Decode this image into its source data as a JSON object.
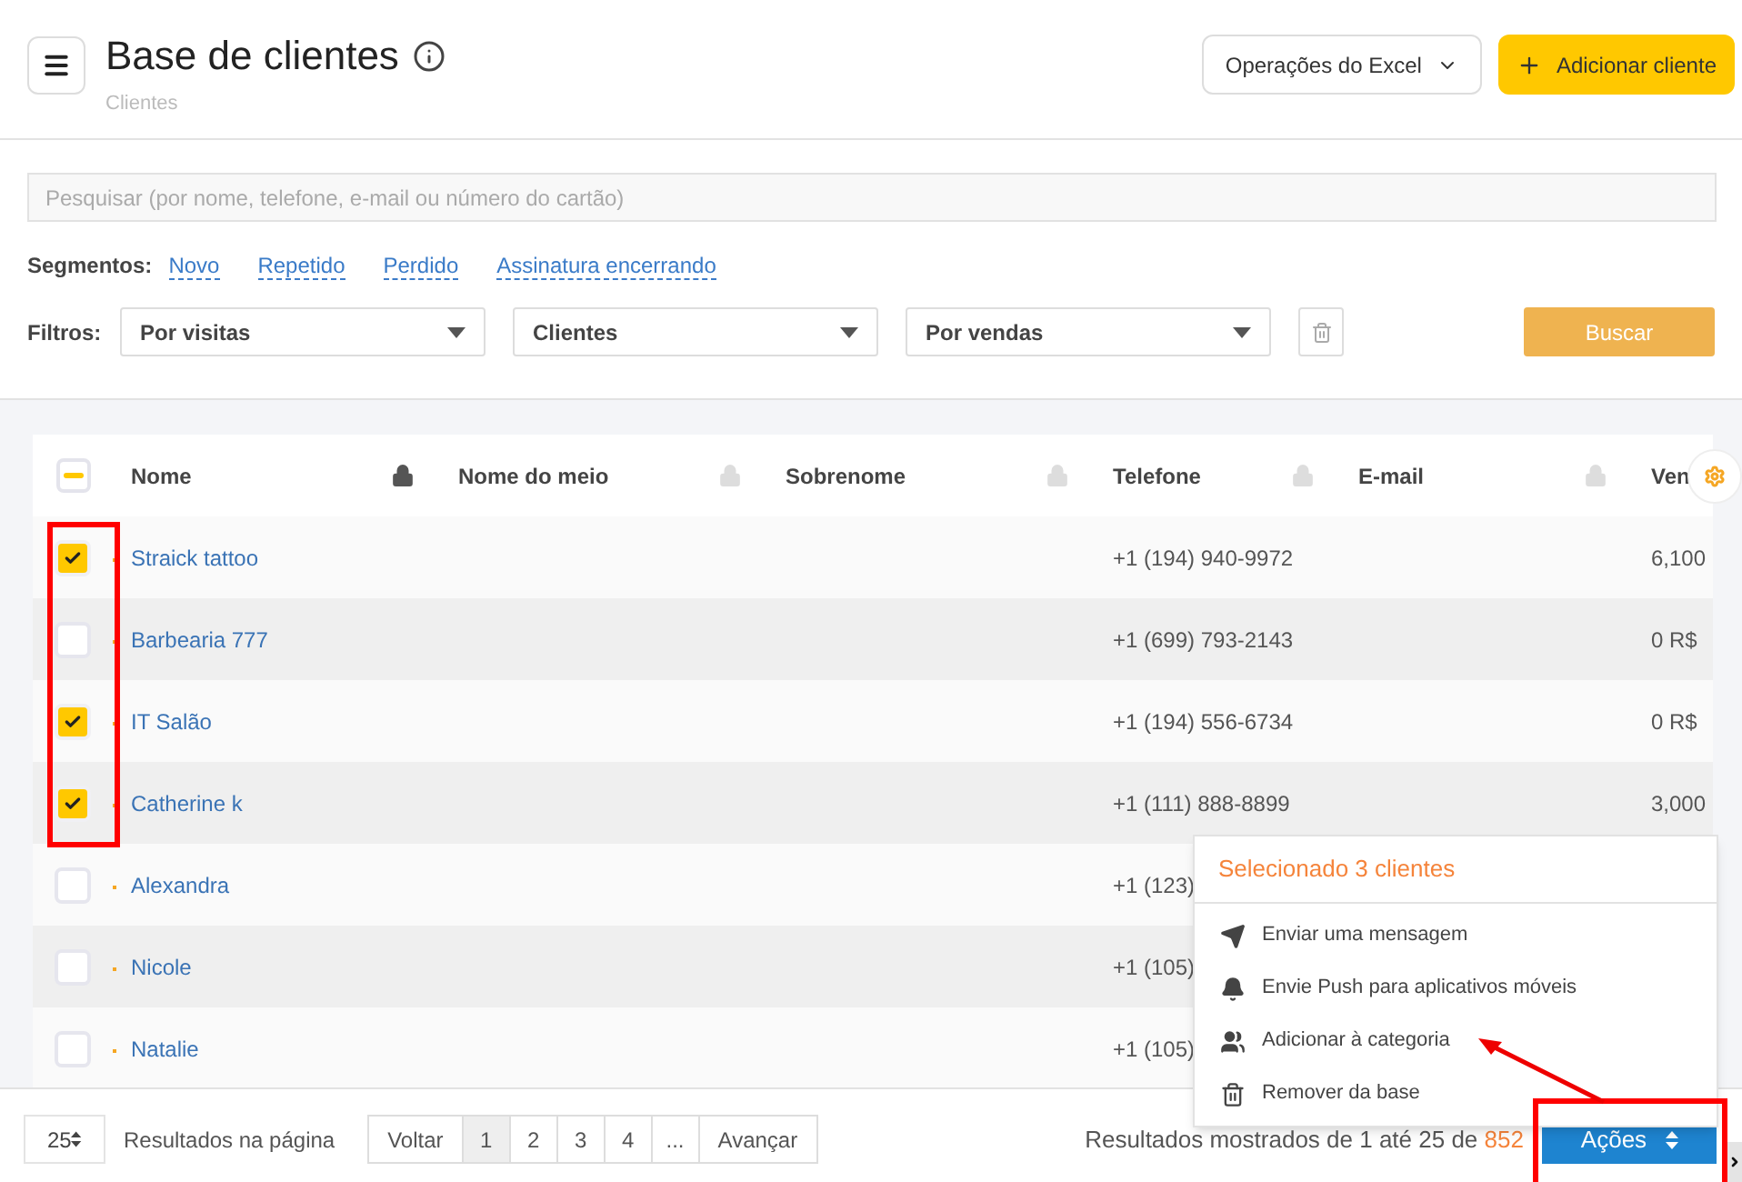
{
  "header": {
    "title": "Base de clientes",
    "subtitle": "Clientes",
    "excel_button": "Operações do Excel",
    "add_button": "Adicionar cliente"
  },
  "search": {
    "placeholder": "Pesquisar (por nome, telefone, e-mail ou número do cartão)"
  },
  "segments": {
    "label": "Segmentos:",
    "links": [
      "Novo",
      "Repetido",
      "Perdido",
      "Assinatura encerrando"
    ]
  },
  "filters": {
    "label": "Filtros:",
    "selects": [
      "Por visitas",
      "Clientes",
      "Por vendas"
    ],
    "search_button": "Buscar"
  },
  "table": {
    "header_checkbox": {
      "indeterminate": true
    },
    "columns": [
      {
        "label": "Nome",
        "locked": true
      },
      {
        "label": "Nome do meio",
        "locked": false
      },
      {
        "label": "Sobrenome",
        "locked": false
      },
      {
        "label": "Telefone",
        "locked": false
      },
      {
        "label": "E-mail",
        "locked": false
      },
      {
        "label": "Ven"
      }
    ],
    "rows": [
      {
        "checked": true,
        "name": "Straick tattoo",
        "phone": "+1 (194) 940-9972",
        "sales": "6,100"
      },
      {
        "checked": false,
        "name": "Barbearia 777",
        "phone": "+1 (699) 793-2143",
        "sales": "0 R$"
      },
      {
        "checked": true,
        "name": "IT Salão",
        "phone": "+1 (194) 556-6734",
        "sales": "0 R$"
      },
      {
        "checked": true,
        "name": "Catherine k",
        "phone": "+1 (111) 888-8899",
        "sales": "3,000"
      },
      {
        "checked": false,
        "name": "Alexandra",
        "phone": "+1 (123)"
      },
      {
        "checked": false,
        "name": "Nicole",
        "phone": "+1 (105)"
      },
      {
        "checked": false,
        "name": "Natalie",
        "phone": "+1 (105)"
      }
    ]
  },
  "actions_menu": {
    "title": "Selecionado 3 clientes",
    "items": [
      {
        "kind": "message",
        "label": "Enviar uma mensagem"
      },
      {
        "kind": "push",
        "label": "Envie Push para aplicativos móveis"
      },
      {
        "kind": "category",
        "label": "Adicionar à categoria"
      },
      {
        "kind": "remove",
        "label": "Remover da base"
      }
    ]
  },
  "footer": {
    "page_size": "25",
    "page_size_label": "Resultados na página",
    "prev": "Voltar",
    "pages": [
      {
        "label": "1",
        "selected": true
      },
      {
        "label": "2",
        "selected": false
      },
      {
        "label": "3",
        "selected": false
      },
      {
        "label": "4",
        "selected": false
      },
      {
        "label": "...",
        "selected": false
      }
    ],
    "next": "Avançar",
    "results_text": "Resultados mostrados de 1 até 25 de",
    "total": "852",
    "actions_button": "Ações"
  }
}
